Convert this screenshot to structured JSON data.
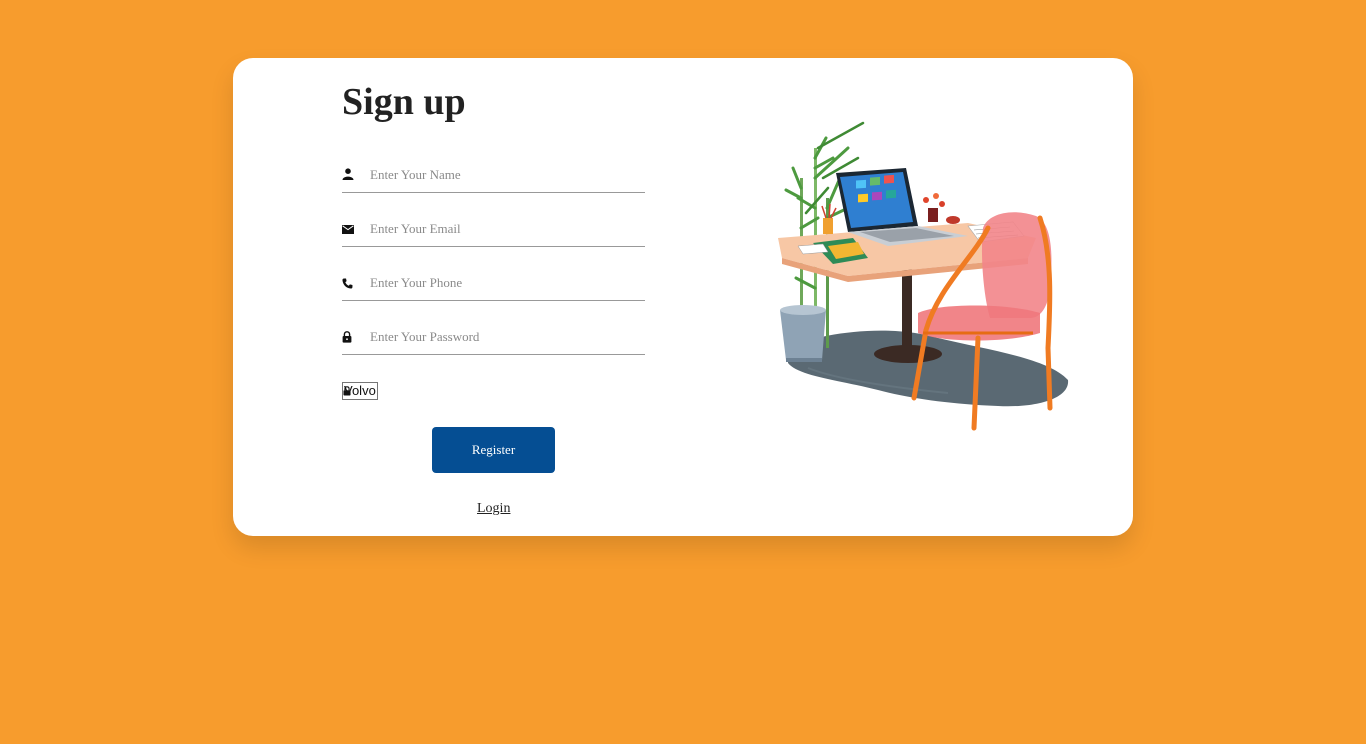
{
  "page": {
    "background_color": "#f79c2d"
  },
  "form": {
    "title": "Sign up",
    "fields": [
      {
        "name": "name",
        "icon": "person-icon",
        "placeholder": "Enter Your Name",
        "value": ""
      },
      {
        "name": "email",
        "icon": "envelope-icon",
        "placeholder": "Enter Your Email",
        "value": ""
      },
      {
        "name": "phone",
        "icon": "phone-icon",
        "placeholder": "Enter Your Phone",
        "value": ""
      },
      {
        "name": "password",
        "icon": "lock-icon",
        "placeholder": "Enter Your Password",
        "value": ""
      }
    ],
    "select": {
      "selected": "Volvo",
      "icon": "lock-icon"
    },
    "register_label": "Register",
    "register_color": "#054e93",
    "login_label": "Login"
  },
  "illustration": {
    "name": "desk-with-laptop-illustration"
  }
}
